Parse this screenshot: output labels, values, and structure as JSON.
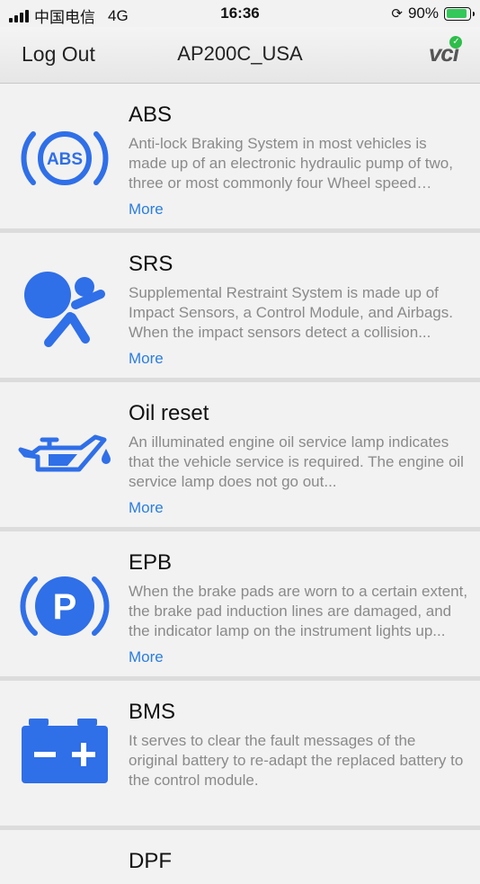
{
  "status": {
    "carrier": "中国电信",
    "network": "4G",
    "time": "16:36",
    "battery": "90%",
    "battery_level": 0.9,
    "colors": {
      "battery_fill": "#34c759"
    }
  },
  "nav": {
    "left_label": "Log Out",
    "title": "AP200C_USA",
    "right_logo": "vci",
    "right_logo_badge_color": "#2dbe4a"
  },
  "accent_color": "#2f6fe8",
  "more_label": "More",
  "items": [
    {
      "title": "ABS",
      "icon": "abs-icon",
      "description": "Anti-lock Braking System in most vehicles is made up of an electronic hydraulic pump of two, three or most commonly four Wheel speed sensors...",
      "more": "More"
    },
    {
      "title": "SRS",
      "icon": "airbag-icon",
      "description": "Supplemental Restraint System is made up of Impact Sensors, a Control Module, and Airbags. When the impact sensors detect a collision...",
      "more": "More"
    },
    {
      "title": "Oil reset",
      "icon": "oil-can-icon",
      "description": "An illuminated engine oil service lamp indicates that the vehicle service is required. The engine oil service lamp does not go out...",
      "more": "More"
    },
    {
      "title": "EPB",
      "icon": "parking-brake-icon",
      "description": "When the brake pads are worn to a certain extent, the brake pad induction lines are damaged, and the indicator lamp on the instrument lights up...",
      "more": "More"
    },
    {
      "title": "BMS",
      "icon": "battery-icon",
      "description": "It serves to clear the fault messages of the original battery to re-adapt the replaced battery to the control module."
    },
    {
      "title": "DPF"
    }
  ]
}
